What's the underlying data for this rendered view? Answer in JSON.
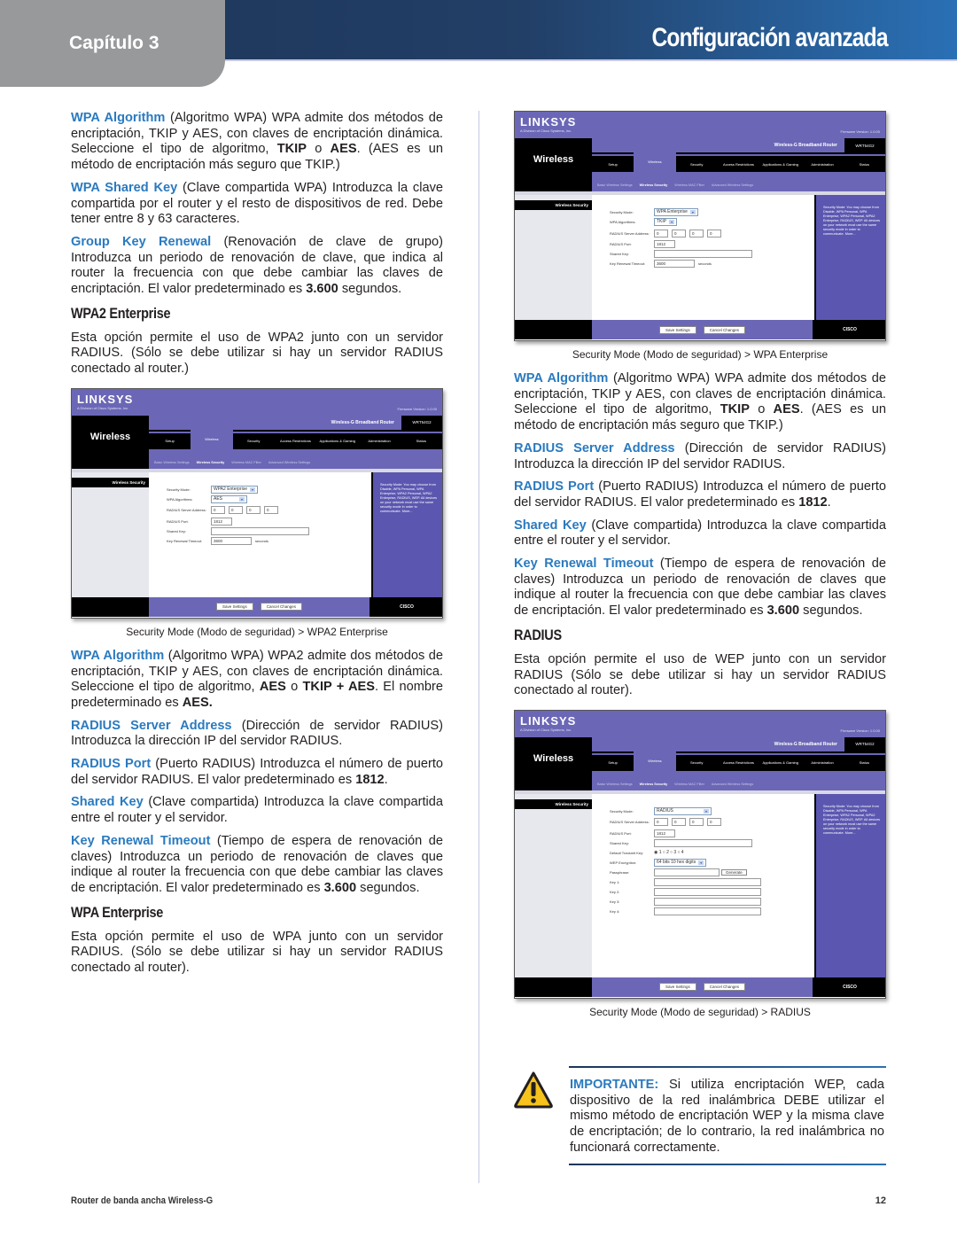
{
  "header": {
    "chapter": "Capítulo 3",
    "title": "Configuración avanzada"
  },
  "left": {
    "p1": {
      "term": "WPA Algorithm",
      "t1": " (Algoritmo WPA) WPA admite dos métodos de encriptación, TKIP y AES, con claves de encriptación dinámica. Seleccione el tipo de algoritmo, ",
      "b1": "TKIP",
      "t2": " o ",
      "b2": "AES",
      "t3": ". (AES es un método de encriptación más seguro que TKIP.)"
    },
    "p2": {
      "term": "WPA Shared Key",
      "t1": " (Clave compartida WPA) Introduzca la clave compartida por el router y el resto de dispositivos de red. Debe tener entre 8 y 63 caracteres."
    },
    "p3": {
      "term": "Group Key Renewal",
      "t1": " (Renovación de clave de grupo) Introduzca un periodo de renovación de clave, que indica al router la frecuencia con que debe cambiar las claves de encriptación. El valor predeterminado es ",
      "b1": "3.600",
      "t2": " segundos."
    },
    "h_wpa2": "WPA2 Enterprise",
    "p4": "Esta opción permite el uso de WPA2 junto con un servidor RADIUS. (Sólo se debe utilizar si hay un servidor RADIUS conectado al router.)",
    "caption1": "Security Mode (Modo de seguridad) > WPA2 Enterprise",
    "p5": {
      "term": "WPA Algorithm",
      "t1": " (Algoritmo WPA) WPA2 admite dos métodos de encriptación, TKIP y AES, con claves de encriptación dinámica. Seleccione el tipo de algoritmo, ",
      "b1": "AES",
      "t2": " o ",
      "b2": "TKIP + AES",
      "t3": ". El nombre predeterminado es ",
      "b3": "AES."
    },
    "p6": {
      "term": "RADIUS Server Address",
      "t1": " (Dirección de servidor RADIUS) Introduzca la dirección IP del servidor RADIUS."
    },
    "p7": {
      "term": "RADIUS Port",
      "t1": " (Puerto RADIUS) Introduzca el número de puerto del servidor RADIUS. El valor predeterminado es ",
      "b1": "1812",
      "t2": "."
    },
    "p8": {
      "term": "Shared Key",
      "t1": " (Clave compartida) Introduzca la clave compartida entre el router y el servidor."
    },
    "p9": {
      "term": "Key Renewal Timeout",
      "t1": " (Tiempo de espera de renovación de claves) Introduzca un periodo de renovación de claves que indique al router la frecuencia con que debe cambiar las claves de encriptación. El valor predeterminado es ",
      "b1": "3.600",
      "t2": " segundos."
    },
    "h_wpa": "WPA Enterprise",
    "p10": "Esta opción permite el uso de WPA junto con un servidor RADIUS. (Sólo se debe utilizar si hay un servidor RADIUS conectado al router)."
  },
  "right": {
    "caption1": "Security Mode (Modo de seguridad) > WPA Enterprise",
    "p1": {
      "term": "WPA Algorithm",
      "t1": " (Algoritmo WPA) WPA admite dos métodos de encriptación, TKIP y AES, con claves de encriptación dinámica. Seleccione el tipo de algoritmo, ",
      "b1": "TKIP",
      "t2": " o ",
      "b2": "AES",
      "t3": ". (AES es un método de encriptación más seguro que TKIP.)"
    },
    "p2": {
      "term": "RADIUS Server Address",
      "t1": " (Dirección de servidor RADIUS) Introduzca la dirección IP del servidor RADIUS."
    },
    "p3": {
      "term": "RADIUS Port",
      "t1": " (Puerto RADIUS) Introduzca el número de puerto del servidor RADIUS. El valor predeterminado es ",
      "b1": "1812",
      "t2": "."
    },
    "p4": {
      "term": "Shared Key",
      "t1": " (Clave compartida) Introduzca la clave compartida entre el router y el servidor."
    },
    "p5": {
      "term": "Key Renewal Timeout",
      "t1": " (Tiempo de espera de renovación de claves) Introduzca un periodo de renovación de claves que indique al router la frecuencia con que debe cambiar las claves de encriptación. El valor predeterminado es ",
      "b1": "3.600",
      "t2": " segundos."
    },
    "h_radius": "RADIUS",
    "p6": "Esta opción permite el uso de WEP junto con un servidor RADIUS (Sólo se debe utilizar si hay un servidor RADIUS conectado al router).",
    "caption2": "Security Mode (Modo de seguridad) > RADIUS"
  },
  "important": {
    "label": "IMPORTANTE:",
    "text": " Si utiliza encriptación WEP, cada dispositivo de la red inalámbrica DEBE utilizar el mismo método de encriptación WEP y la misma clave de encriptación; de lo contrario, la red inalámbrica no funcionará correctamente."
  },
  "router": {
    "logo": "LINKSYS",
    "logo_sub": "A Division of Cisco Systems, Inc.",
    "firmware": "Firmware Version: 1.0.00",
    "section": "Wireless",
    "product": "Wireless-G Broadband Router",
    "model": "WRT54G2",
    "tabs": [
      "Setup",
      "Wireless",
      "Security",
      "Access Restrictions",
      "Applications & Gaming",
      "Administration",
      "Status"
    ],
    "subtabs": [
      "Basic Wireless Settings",
      "Wireless Security",
      "Wireless MAC Filter",
      "Advanced Wireless Settings"
    ],
    "side_label": "Wireless Security",
    "help": "Security Mode: You may choose from Disable, WPA Personal, WPA Enterprise, WPA2 Personal, WPA2 Enterprise, RADIUS, WEP. All devices on your network must use the same security mode in order to communicate. More...",
    "labels": {
      "security_mode": "Security Mode:",
      "wpa_algorithms": "WPA Algorithms:",
      "radius_server": "RADIUS Server Address:",
      "radius_port": "RADIUS Port:",
      "shared_key": "Shared Key:",
      "key_renewal": "Key Renewal Timeout:",
      "seconds": "seconds",
      "default_tx_key": "Default Transmit Key:",
      "wep_encryption": "WEP Encryption:",
      "passphrase": "Passphrase:",
      "key1": "Key 1:",
      "key2": "Key 2:",
      "key3": "Key 3:",
      "key4": "Key 4:"
    },
    "save": "Save Settings",
    "cancel": "Cancel Changes",
    "generate": "Generate",
    "cisco": "CISCO",
    "shot1": {
      "mode": "WPA2 Enterprise",
      "algo": "AES",
      "ip": [
        "0",
        "0",
        "0",
        "0"
      ],
      "port": "1812",
      "timeout": "3600"
    },
    "shot2": {
      "mode": "WPA Enterprise",
      "algo": "TKIP",
      "ip": [
        "0",
        "0",
        "0",
        "0"
      ],
      "port": "1812",
      "timeout": "3600"
    },
    "shot3": {
      "mode": "RADIUS",
      "ip": [
        "0",
        "0",
        "0",
        "0"
      ],
      "port": "1812",
      "tx_keys": [
        "1",
        "2",
        "3",
        "4"
      ],
      "tx_selected": "1",
      "wep": "64 bits 10 hex digits"
    }
  },
  "footer": {
    "product": "Router de banda ancha Wireless-G",
    "page": "12"
  }
}
